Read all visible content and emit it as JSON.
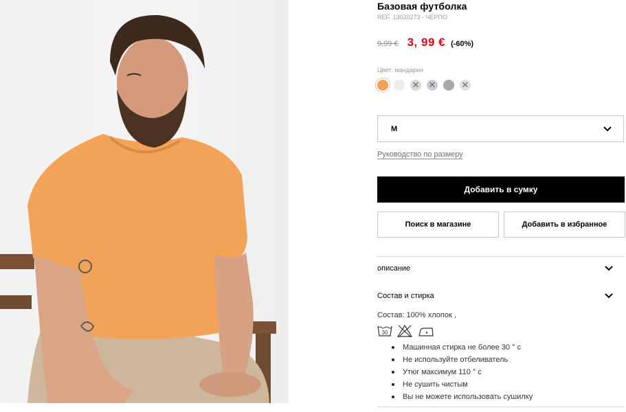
{
  "product": {
    "title": "Базовая футболка",
    "ref_label": "REF.",
    "ref_value": "13020273 - ЧЕРПО",
    "old_price": "9,99 €",
    "new_price": "3, 99  €",
    "discount": "(-60%)",
    "image_icon": "model-photo"
  },
  "colors": {
    "label": "Цвет:",
    "selected_name": "мандарин",
    "swatches": [
      {
        "hex": "#f4a056",
        "available": true,
        "selected": true
      },
      {
        "hex": "#ececec",
        "available": true,
        "selected": false
      },
      {
        "hex": "#d6dbd8",
        "available": false,
        "selected": false
      },
      {
        "hex": "#c9ccd3",
        "available": false,
        "selected": false
      },
      {
        "hex": "#a8a8a8",
        "available": true,
        "selected": false
      },
      {
        "hex": "#e1e1e1",
        "available": false,
        "selected": false
      }
    ],
    "unavailable_icon": "cross-icon"
  },
  "size": {
    "selected": "M",
    "icon": "chevron-down-icon",
    "guide_label": "Руководство по размеру"
  },
  "actions": {
    "add_to_bag": "Добавить в сумку",
    "find_in_store": "Поиск в магазине",
    "add_to_favorites": "Добавить в избранное"
  },
  "accordions": {
    "description": "описание",
    "composition_care": "Состав и стирка"
  },
  "care": {
    "composition": "Состав: 100% хлопок ,",
    "wash_temp_icon_text": "30",
    "icons": [
      "wash-30-icon",
      "no-bleach-icon",
      "iron-icon"
    ],
    "instructions": [
      "Машинная стирка не более 30 ° с",
      "Не используйте отбеливатель",
      "Утюг максимум 110 ° с",
      "Не сушить чистым",
      "Вы не можете использовать сушилку"
    ]
  },
  "theme": {
    "accent_price": "#e2001a",
    "primary_button": "#000000",
    "border": "#c8c8c8"
  }
}
